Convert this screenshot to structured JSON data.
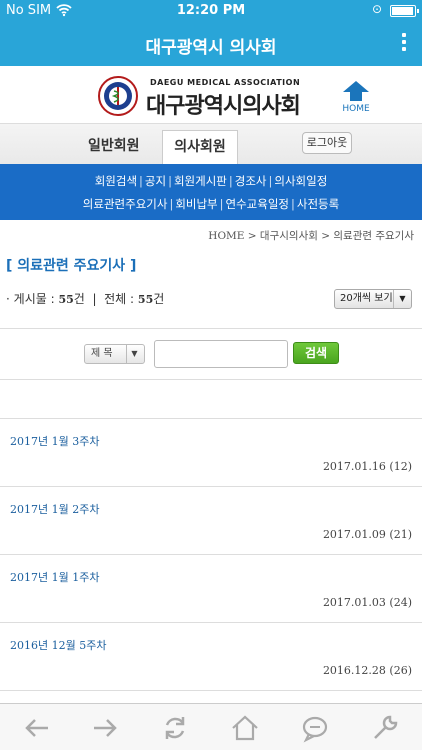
{
  "status": {
    "carrier": "No SIM",
    "time": "12:20 PM",
    "battery_level": 0.95
  },
  "navbar": {
    "title": "대구광역시 의사회",
    "menu_icon": "more-vertical-icon"
  },
  "header": {
    "logo_icon": "medical-association-seal-icon",
    "eng_name": "DAEGU MEDICAL ASSOCIATION",
    "kor_name": "대구광역시의사회",
    "home_label": "HOME"
  },
  "tabs": {
    "general": "일반회원",
    "doctor": "의사회원",
    "logout": "로그아웃"
  },
  "menu": {
    "row1": [
      "회원검색",
      "공지",
      "회원게시판",
      "경조사",
      "의사회일정"
    ],
    "row2": [
      "의료관련주요기사",
      "회비납부",
      "연수교육일정",
      "사전등록"
    ],
    "separator": "|"
  },
  "breadcrumb": "HOME > 대구시의사회 > 의료관련 주요기사",
  "section_title": "[ 의료관련 주요기사 ]",
  "counts": {
    "posts_label": "게시물 :",
    "posts_value": "55",
    "posts_unit": "건",
    "total_label": "전체 :",
    "total_value": "55",
    "total_unit": "건",
    "bullet": "·"
  },
  "per_page": {
    "selected": "20개씩 보기"
  },
  "search": {
    "field_selected": "제 목",
    "input_value": "",
    "button_label": "검색"
  },
  "articles": [
    {
      "title": "2017년 1월 3주차",
      "meta": "2017.01.16 (12)"
    },
    {
      "title": "2017년 1월 2주차",
      "meta": "2017.01.09 (21)"
    },
    {
      "title": "2017년 1월 1주차",
      "meta": "2017.01.03 (24)"
    },
    {
      "title": "2016년 12월 5주차",
      "meta": "2016.12.28 (26)"
    }
  ],
  "toolbar": [
    "back-arrow-icon",
    "forward-arrow-icon",
    "refresh-icon",
    "home-icon",
    "chat-bubble-icon",
    "wrench-icon"
  ],
  "colors": {
    "nav": "#29a5d8",
    "menubar": "#1a6cc6",
    "accent_text": "#1b6fb8",
    "search_button": "#4aa51f",
    "home_icon": "#1b75bb"
  }
}
